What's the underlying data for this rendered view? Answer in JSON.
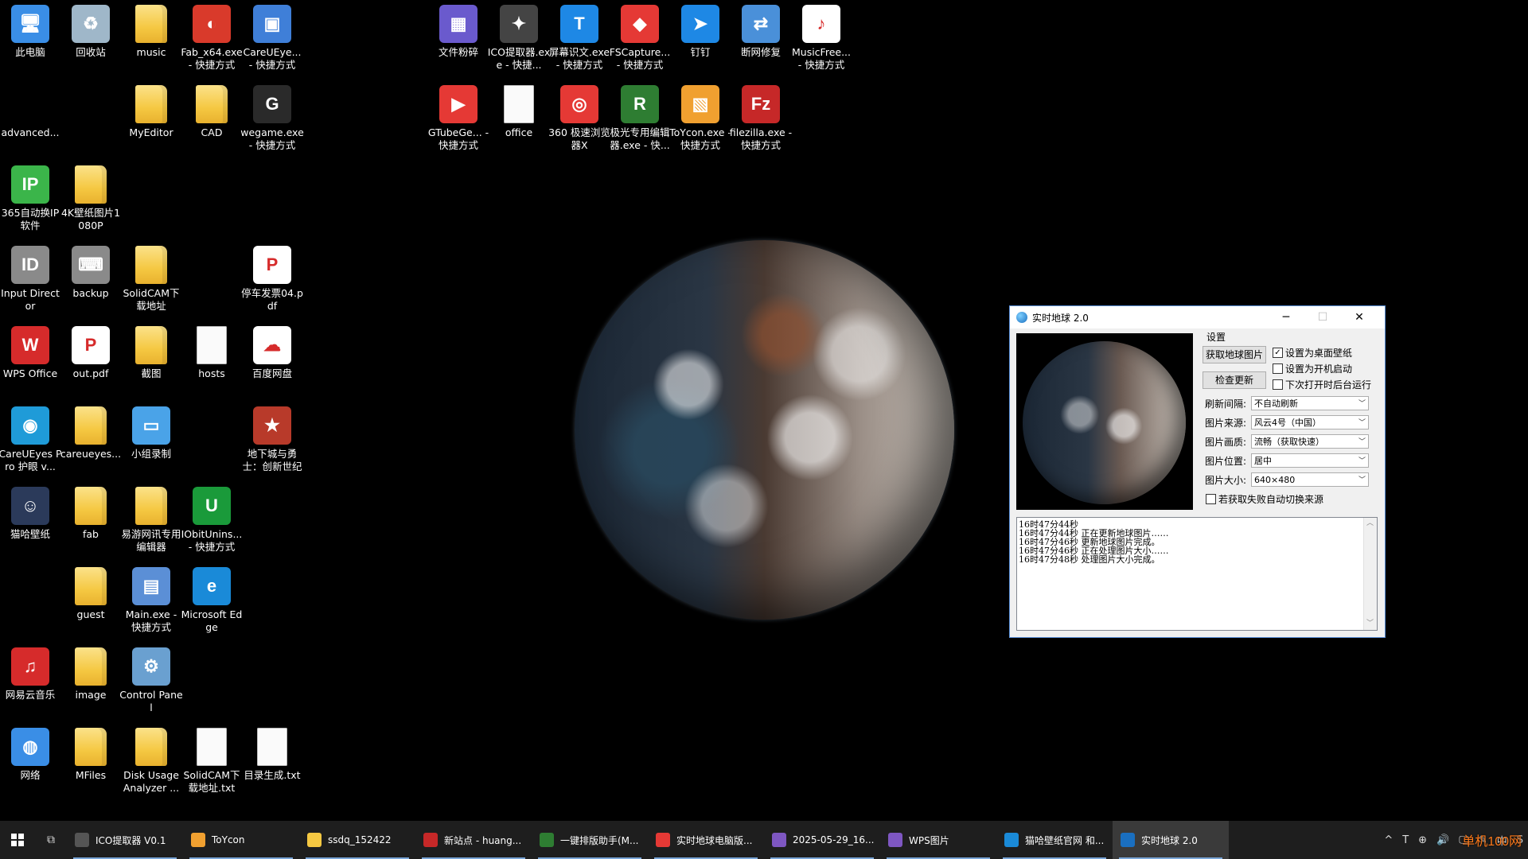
{
  "desktop_icons": [
    {
      "label": "此电脑",
      "color": "#3a8ee6",
      "glyph": "🖥"
    },
    {
      "label": "回收站",
      "color": "#9fb7c9",
      "glyph": "♻"
    },
    {
      "label": "music",
      "color": "folder",
      "glyph": ""
    },
    {
      "label": "Fab_x64.exe - 快捷方式",
      "color": "#d93a2b",
      "glyph": "◐"
    },
    {
      "label": "CareUEye... - 快捷方式",
      "color": "#3f7fd8",
      "glyph": "▣"
    },
    {
      "label": "advanced...",
      "color": "none",
      "glyph": ""
    },
    {
      "label": "MyEditor",
      "color": "folder",
      "glyph": ""
    },
    {
      "label": "CAD",
      "color": "folder",
      "glyph": ""
    },
    {
      "label": "wegame.exe - 快捷方式",
      "color": "#2a2a2a",
      "glyph": "G"
    },
    {
      "label": "365自动换IP软件",
      "color": "#3bb54a",
      "glyph": "IP"
    },
    {
      "label": "4K壁纸图片1080P",
      "color": "folder",
      "glyph": ""
    },
    {
      "label": "Input Director",
      "color": "#8a8a8a",
      "glyph": "ID"
    },
    {
      "label": "backup",
      "color": "#8a8a8a",
      "glyph": "⌨"
    },
    {
      "label": "SolidCAM下载地址",
      "color": "folder",
      "glyph": ""
    },
    {
      "label": "停车发票04.pdf",
      "color": "#ffffff",
      "glyph": "P"
    },
    {
      "label": "WPS Office",
      "color": "#d62b2b",
      "glyph": "W"
    },
    {
      "label": "out.pdf",
      "color": "#ffffff",
      "glyph": "P"
    },
    {
      "label": "截图",
      "color": "folder",
      "glyph": ""
    },
    {
      "label": "hosts",
      "color": "doc",
      "glyph": ""
    },
    {
      "label": "百度网盘",
      "color": "#ffffff",
      "glyph": "☁"
    },
    {
      "label": "CareUEyes Pro 护眼 v...",
      "color": "#1f9bd8",
      "glyph": "◉"
    },
    {
      "label": "careueyes...",
      "color": "folder",
      "glyph": ""
    },
    {
      "label": "小组录制",
      "color": "#4aa3e8",
      "glyph": "▭"
    },
    {
      "label": "地下城与勇士：创新世纪",
      "color": "#b83a2a",
      "glyph": "★"
    },
    {
      "label": "猫哈壁纸",
      "color": "#2b3a5a",
      "glyph": "☺"
    },
    {
      "label": "fab",
      "color": "folder",
      "glyph": ""
    },
    {
      "label": "易游网讯专用编辑器",
      "color": "folder",
      "glyph": ""
    },
    {
      "label": "IObitUnins... - 快捷方式",
      "color": "#1a9a3a",
      "glyph": "U"
    },
    {
      "label": "guest",
      "color": "folder",
      "glyph": ""
    },
    {
      "label": "Main.exe - 快捷方式",
      "color": "#5b8fd6",
      "glyph": "▤"
    },
    {
      "label": "Microsoft Edge",
      "color": "#1a8ad8",
      "glyph": "e"
    },
    {
      "label": "网易云音乐",
      "color": "#d62b2b",
      "glyph": "♫"
    },
    {
      "label": "image",
      "color": "folder",
      "glyph": ""
    },
    {
      "label": "Control Panel",
      "color": "#6aa0d0",
      "glyph": "⚙"
    },
    {
      "label": "网络",
      "color": "#3a8ee6",
      "glyph": "◍"
    },
    {
      "label": "MFiles",
      "color": "folder",
      "glyph": ""
    },
    {
      "label": "Disk Usage Analyzer ...",
      "color": "folder",
      "glyph": ""
    },
    {
      "label": "SolidCAM下载地址.txt",
      "color": "doc",
      "glyph": ""
    },
    {
      "label": "目录生成.txt",
      "color": "doc",
      "glyph": ""
    },
    {
      "label": "文件粉碎",
      "color": "#6a5acd",
      "glyph": "▦"
    },
    {
      "label": "ICO提取器.exe - 快捷...",
      "color": "#444444",
      "glyph": "✦"
    },
    {
      "label": "屏幕识文.exe - 快捷方式",
      "color": "#1e88e5",
      "glyph": "T"
    },
    {
      "label": "FSCapture... - 快捷方式",
      "color": "#e53935",
      "glyph": "◆"
    },
    {
      "label": "钉钉",
      "color": "#1e88e5",
      "glyph": "➤"
    },
    {
      "label": "断网修复",
      "color": "#4a90d9",
      "glyph": "⇄"
    },
    {
      "label": "MusicFree... - 快捷方式",
      "color": "#ffffff",
      "glyph": "♪"
    },
    {
      "label": "GTubeGe... - 快捷方式",
      "color": "#e53935",
      "glyph": "▶"
    },
    {
      "label": "office",
      "color": "doc",
      "glyph": ""
    },
    {
      "label": "360 极速浏览器X",
      "color": "#e53935",
      "glyph": "◎"
    },
    {
      "label": "极光专用编辑器.exe - 快...",
      "color": "#2e7d32",
      "glyph": "R"
    },
    {
      "label": "ToYcon.exe - 快捷方式",
      "color": "#f0a030",
      "glyph": "▧"
    },
    {
      "label": "filezilla.exe - 快捷方式",
      "color": "#c62828",
      "glyph": "Fz"
    }
  ],
  "window": {
    "title": "实时地球 2.0",
    "minimize": "─",
    "maximize": "☐",
    "close": "✕",
    "group_label": "设置",
    "btn_fetch": "获取地球图片",
    "btn_check": "检查更新",
    "chk_wallpaper": "设置为桌面壁纸",
    "chk_startup": "设置为开机启动",
    "chk_bg": "下次打开时后台运行",
    "chk_wallpaper_state": "✓",
    "rows": [
      {
        "label": "刷新间隔:",
        "value": "不自动刷新"
      },
      {
        "label": "图片来源:",
        "value": "风云4号（中国）"
      },
      {
        "label": "图片画质:",
        "value": "流畅（获取快速）"
      },
      {
        "label": "图片位置:",
        "value": "居中"
      },
      {
        "label": "图片大小:",
        "value": "640×480"
      }
    ],
    "chk_autoswitch": "若获取失败自动切换来源",
    "log": [
      "16时47分44秒",
      "16时47分44秒 正在更新地球图片……",
      "16时47分46秒 更新地球图片完成。",
      "16时47分46秒 正在处理图片大小……",
      "16时47分48秒 处理图片大小完成。"
    ],
    "scroll_up": "︿",
    "scroll_down": "﹀"
  },
  "taskbar": {
    "items": [
      {
        "label": "ICO提取器 V0.1",
        "color": "#555555"
      },
      {
        "label": "ToYcon",
        "color": "#f0a030"
      },
      {
        "label": "ssdq_152422",
        "color": "#f5c842"
      },
      {
        "label": "新站点 - huang...",
        "color": "#c62828"
      },
      {
        "label": "一键排版助手(M...",
        "color": "#2e7d32"
      },
      {
        "label": "实时地球电脑版...",
        "color": "#e53935"
      },
      {
        "label": "2025-05-29_16...",
        "color": "#7e57c2"
      },
      {
        "label": "WPS图片",
        "color": "#7e57c2"
      },
      {
        "label": "猫哈壁纸官网 和...",
        "color": "#1a8ad8"
      },
      {
        "label": "实时地球 2.0",
        "color": "#1a6fc0"
      }
    ],
    "tray": [
      "^",
      "T",
      "⊕",
      "🔊",
      "🖵",
      "✎",
      "中",
      "S"
    ],
    "watermark": "单机100网"
  }
}
